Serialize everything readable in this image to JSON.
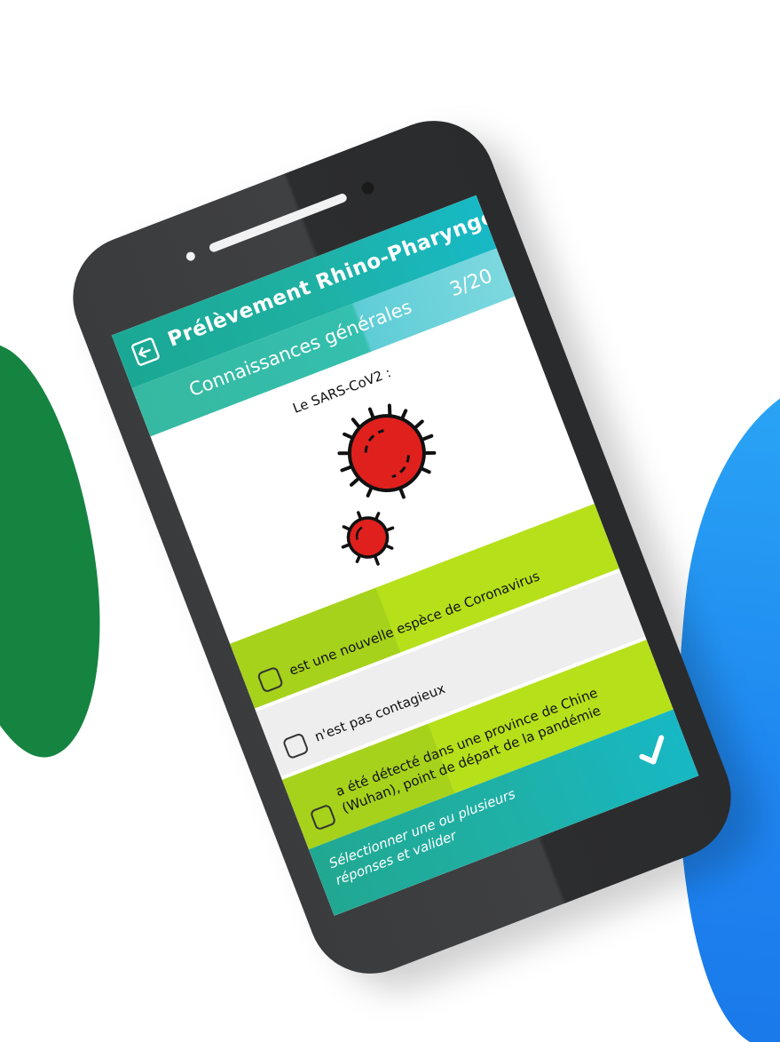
{
  "app": {
    "title": "Prélèvement Rhino-Pharyngé",
    "back_icon": "exit-icon"
  },
  "quiz": {
    "section": "Connaissances générales",
    "progress": "3/20",
    "question": "Le SARS-CoV2 :",
    "illustration_icon": "virus-icon",
    "answers": [
      {
        "text": "est une nouvelle espèce de Coronavirus",
        "checked": false
      },
      {
        "text": "n'est pas contagieux",
        "checked": false
      },
      {
        "text_line1": "a été détecté dans une province de Chine",
        "text_line2": "(Wuhan), point de départ de la pandémie",
        "checked": false
      }
    ]
  },
  "footer": {
    "instruction_line1": "Sélectionner une ou plusieurs",
    "instruction_line2": "réponses et valider",
    "validate_icon": "checkmark-icon"
  },
  "colors": {
    "header": "#1fb0a2",
    "answer_green": "#b6e01a",
    "answer_grey": "#eeeeee",
    "virus_red": "#e0201d",
    "phone_body": "#3a3b3d",
    "blob_green": "#168441",
    "blob_blue": "#1e86f0"
  }
}
